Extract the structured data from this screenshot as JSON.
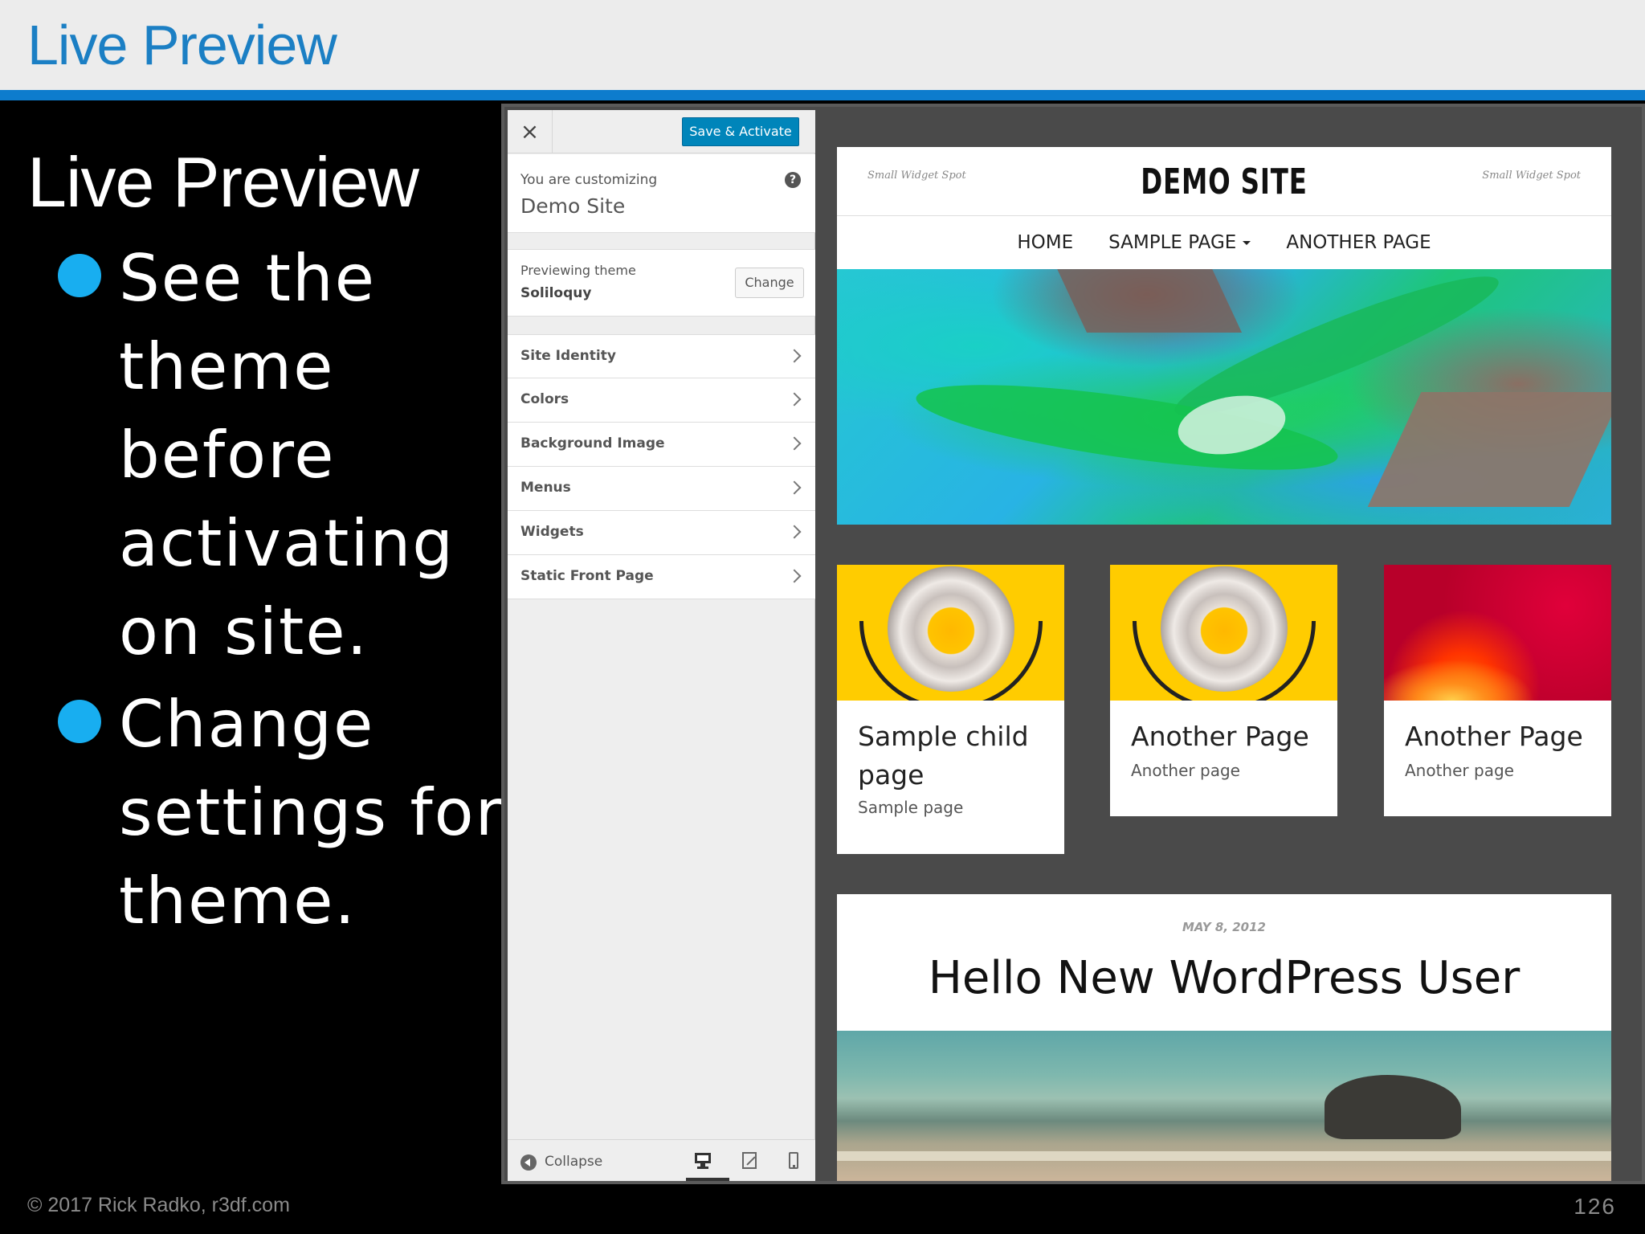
{
  "slide": {
    "header_title": "Live Preview",
    "heading": "Live Preview",
    "bullets": [
      "See the theme before activating on site.",
      "Change settings for theme."
    ],
    "footer": "© 2017 Rick Radko, r3df.com",
    "page_number": "126",
    "accent_color": "#0d7ccd",
    "bullet_color": "#18aef0"
  },
  "customizer": {
    "close_icon": "close-icon",
    "close_symbol": "×",
    "save_label": "Save & Activate",
    "customizing_label": "You are customizing",
    "site_name": "Demo Site",
    "help_symbol": "?",
    "previewing_label": "Previewing theme",
    "theme_name": "Soliloquy",
    "change_label": "Change",
    "sections": [
      {
        "label": "Site Identity"
      },
      {
        "label": "Colors"
      },
      {
        "label": "Background Image"
      },
      {
        "label": "Menus"
      },
      {
        "label": "Widgets"
      },
      {
        "label": "Static Front Page"
      }
    ],
    "collapse_label": "Collapse",
    "devices": [
      "desktop-icon",
      "tablet-icon",
      "mobile-icon"
    ],
    "save_color": "#0085ba"
  },
  "preview": {
    "widget_left": "Small Widget Spot",
    "widget_right": "Small Widget Spot",
    "site_title": "DEMO SITE",
    "nav": [
      {
        "label": "HOME"
      },
      {
        "label": "SAMPLE PAGE"
      },
      {
        "label": "ANOTHER PAGE"
      }
    ],
    "cards": [
      {
        "title": "Sample child page",
        "subtitle": "Sample page"
      },
      {
        "title": "Another Page",
        "subtitle": "Another page"
      },
      {
        "title": "Another Page",
        "subtitle": "Another page"
      }
    ],
    "post_date": "MAY 8, 2012",
    "post_title": "Hello New WordPress User"
  }
}
